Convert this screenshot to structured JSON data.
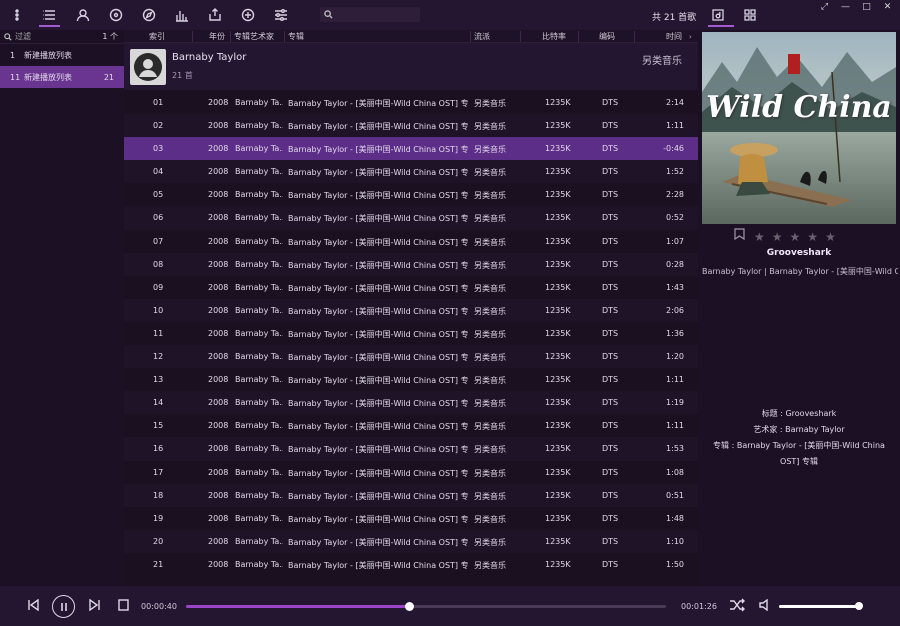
{
  "toolbar": {
    "icons": [
      "menu-icon",
      "list-icon",
      "user-icon",
      "disc-icon",
      "compass-icon",
      "equalizer-icon",
      "export-icon",
      "add-icon",
      "sliders-icon"
    ],
    "search_placeholder": "",
    "search_value": "",
    "track_count": "共 21 首歌",
    "window_controls": [
      "⤢",
      "—",
      "□",
      "✕"
    ]
  },
  "sidebar": {
    "filter_placeholder": "过滤",
    "filter_count": "1 个",
    "items": [
      {
        "index": "1",
        "label": "新建播放列表",
        "count": "",
        "selected": false
      },
      {
        "index": "11",
        "label": "新建播放列表",
        "count": "21",
        "selected": true
      }
    ]
  },
  "columns": {
    "index": "索引",
    "year": "年份",
    "album_artist": "专辑艺术家",
    "album": "专辑",
    "genre": "流派",
    "bitrate": "比特率",
    "codec": "编码",
    "duration": "时间"
  },
  "group": {
    "artist": "Barnaby Taylor",
    "count": "21 首",
    "genre": "另类音乐"
  },
  "tracks": [
    {
      "index": "01",
      "year": "2008",
      "artist": "Barnaby Ta...",
      "album": "Barnaby Taylor - [美丽中国-Wild China OST] 专辑",
      "genre": "另类音乐",
      "bitrate": "1235K",
      "codec": "DTS",
      "time": "2:14"
    },
    {
      "index": "02",
      "year": "2008",
      "artist": "Barnaby Ta...",
      "album": "Barnaby Taylor - [美丽中国-Wild China OST] 专辑",
      "genre": "另类音乐",
      "bitrate": "1235K",
      "codec": "DTS",
      "time": "1:11"
    },
    {
      "index": "03",
      "year": "2008",
      "artist": "Barnaby Ta...",
      "album": "Barnaby Taylor - [美丽中国-Wild China OST] 专辑",
      "genre": "另类音乐",
      "bitrate": "1235K",
      "codec": "DTS",
      "time": "-0:46"
    },
    {
      "index": "04",
      "year": "2008",
      "artist": "Barnaby Ta...",
      "album": "Barnaby Taylor - [美丽中国-Wild China OST] 专辑",
      "genre": "另类音乐",
      "bitrate": "1235K",
      "codec": "DTS",
      "time": "1:52"
    },
    {
      "index": "05",
      "year": "2008",
      "artist": "Barnaby Ta...",
      "album": "Barnaby Taylor - [美丽中国-Wild China OST] 专辑",
      "genre": "另类音乐",
      "bitrate": "1235K",
      "codec": "DTS",
      "time": "2:28"
    },
    {
      "index": "06",
      "year": "2008",
      "artist": "Barnaby Ta...",
      "album": "Barnaby Taylor - [美丽中国-Wild China OST] 专辑",
      "genre": "另类音乐",
      "bitrate": "1235K",
      "codec": "DTS",
      "time": "0:52"
    },
    {
      "index": "07",
      "year": "2008",
      "artist": "Barnaby Ta...",
      "album": "Barnaby Taylor - [美丽中国-Wild China OST] 专辑",
      "genre": "另类音乐",
      "bitrate": "1235K",
      "codec": "DTS",
      "time": "1:07"
    },
    {
      "index": "08",
      "year": "2008",
      "artist": "Barnaby Ta...",
      "album": "Barnaby Taylor - [美丽中国-Wild China OST] 专辑",
      "genre": "另类音乐",
      "bitrate": "1235K",
      "codec": "DTS",
      "time": "0:28"
    },
    {
      "index": "09",
      "year": "2008",
      "artist": "Barnaby Ta...",
      "album": "Barnaby Taylor - [美丽中国-Wild China OST] 专辑",
      "genre": "另类音乐",
      "bitrate": "1235K",
      "codec": "DTS",
      "time": "1:43"
    },
    {
      "index": "10",
      "year": "2008",
      "artist": "Barnaby Ta...",
      "album": "Barnaby Taylor - [美丽中国-Wild China OST] 专辑",
      "genre": "另类音乐",
      "bitrate": "1235K",
      "codec": "DTS",
      "time": "2:06"
    },
    {
      "index": "11",
      "year": "2008",
      "artist": "Barnaby Ta...",
      "album": "Barnaby Taylor - [美丽中国-Wild China OST] 专辑",
      "genre": "另类音乐",
      "bitrate": "1235K",
      "codec": "DTS",
      "time": "1:36"
    },
    {
      "index": "12",
      "year": "2008",
      "artist": "Barnaby Ta...",
      "album": "Barnaby Taylor - [美丽中国-Wild China OST] 专辑",
      "genre": "另类音乐",
      "bitrate": "1235K",
      "codec": "DTS",
      "time": "1:20"
    },
    {
      "index": "13",
      "year": "2008",
      "artist": "Barnaby Ta...",
      "album": "Barnaby Taylor - [美丽中国-Wild China OST] 专辑",
      "genre": "另类音乐",
      "bitrate": "1235K",
      "codec": "DTS",
      "time": "1:11"
    },
    {
      "index": "14",
      "year": "2008",
      "artist": "Barnaby Ta...",
      "album": "Barnaby Taylor - [美丽中国-Wild China OST] 专辑",
      "genre": "另类音乐",
      "bitrate": "1235K",
      "codec": "DTS",
      "time": "1:19"
    },
    {
      "index": "15",
      "year": "2008",
      "artist": "Barnaby Ta...",
      "album": "Barnaby Taylor - [美丽中国-Wild China OST] 专辑",
      "genre": "另类音乐",
      "bitrate": "1235K",
      "codec": "DTS",
      "time": "1:11"
    },
    {
      "index": "16",
      "year": "2008",
      "artist": "Barnaby Ta...",
      "album": "Barnaby Taylor - [美丽中国-Wild China OST] 专辑",
      "genre": "另类音乐",
      "bitrate": "1235K",
      "codec": "DTS",
      "time": "1:53"
    },
    {
      "index": "17",
      "year": "2008",
      "artist": "Barnaby Ta...",
      "album": "Barnaby Taylor - [美丽中国-Wild China OST] 专辑",
      "genre": "另类音乐",
      "bitrate": "1235K",
      "codec": "DTS",
      "time": "1:08"
    },
    {
      "index": "18",
      "year": "2008",
      "artist": "Barnaby Ta...",
      "album": "Barnaby Taylor - [美丽中国-Wild China OST] 专辑",
      "genre": "另类音乐",
      "bitrate": "1235K",
      "codec": "DTS",
      "time": "0:51"
    },
    {
      "index": "19",
      "year": "2008",
      "artist": "Barnaby Ta...",
      "album": "Barnaby Taylor - [美丽中国-Wild China OST] 专辑",
      "genre": "另类音乐",
      "bitrate": "1235K",
      "codec": "DTS",
      "time": "1:48"
    },
    {
      "index": "20",
      "year": "2008",
      "artist": "Barnaby Ta...",
      "album": "Barnaby Taylor - [美丽中国-Wild China OST] 专辑",
      "genre": "另类音乐",
      "bitrate": "1235K",
      "codec": "DTS",
      "time": "1:10"
    },
    {
      "index": "21",
      "year": "2008",
      "artist": "Barnaby Ta...",
      "album": "Barnaby Taylor - [美丽中国-Wild China OST] 专辑",
      "genre": "另类音乐",
      "bitrate": "1235K",
      "codec": "DTS",
      "time": "1:50"
    }
  ],
  "playing_index": 2,
  "right_panel": {
    "cover_text": "Wild China",
    "title": "Grooveshark",
    "subtitle": "Barnaby Taylor  |  Barnaby Taylor - [美丽中国-Wild China OST] 专辑",
    "rating": 0,
    "info_title": "标题 : Grooveshark",
    "info_artist": "艺术家 : Barnaby Taylor",
    "info_album": "专辑 : Barnaby Taylor - [美丽中国-Wild China OST] 专辑"
  },
  "player": {
    "elapsed": "00:00:40",
    "remaining": "00:01:26",
    "progress": 0.465,
    "volume": 0.98
  },
  "colors": {
    "accent": "#9a44c8",
    "selected_row": "#5c2e88",
    "background": "#1a1020"
  }
}
